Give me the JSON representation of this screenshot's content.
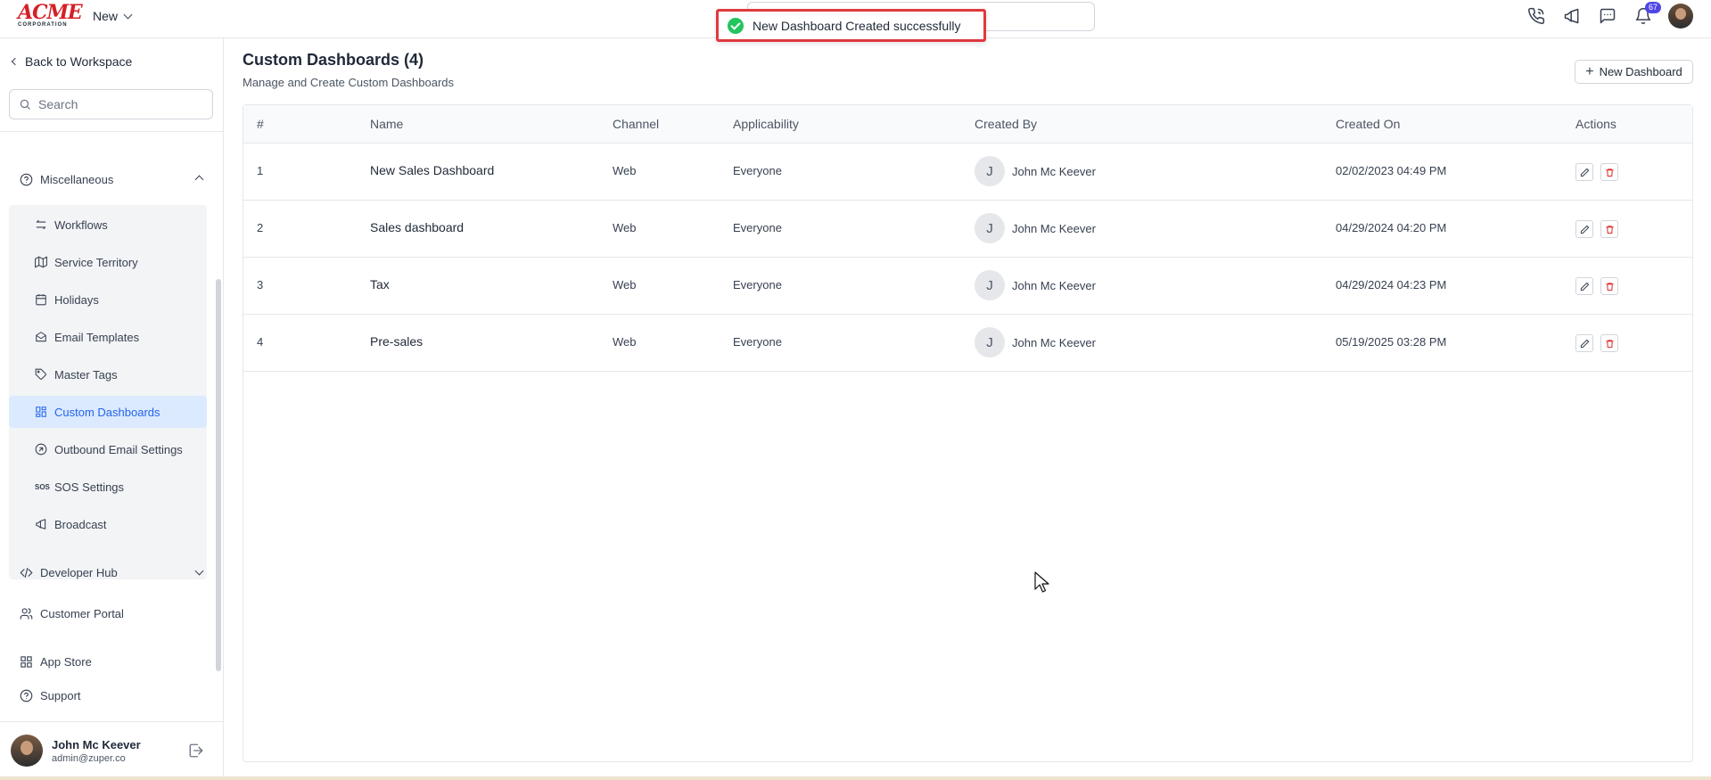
{
  "header": {
    "logo": {
      "main": "ACME",
      "sub": "CORPORATION"
    },
    "new_menu_label": "New",
    "notification_count": "67",
    "icons": [
      "phone-icon",
      "megaphone-icon",
      "chat-icon",
      "bell-icon"
    ]
  },
  "toast": {
    "message": "New Dashboard Created successfully",
    "color": "#22c55e"
  },
  "sidebar": {
    "back_label": "Back to Workspace",
    "search_placeholder": "Search",
    "section_label": "Miscellaneous",
    "sub_items": [
      {
        "label": "Workflows",
        "icon": "workflow-icon"
      },
      {
        "label": "Service Territory",
        "icon": "map-icon"
      },
      {
        "label": "Holidays",
        "icon": "calendar-icon"
      },
      {
        "label": "Email Templates",
        "icon": "mail-open-icon"
      },
      {
        "label": "Master Tags",
        "icon": "tag-icon"
      },
      {
        "label": "Custom Dashboards",
        "icon": "dashboard-icon",
        "active": true
      },
      {
        "label": "Outbound Email Settings",
        "icon": "outbound-icon"
      },
      {
        "label": "SOS Settings",
        "icon": "sos-icon"
      },
      {
        "label": "Broadcast",
        "icon": "megaphone-icon"
      }
    ],
    "developer_hub": "Developer Hub",
    "customer_portal": "Customer Portal",
    "app_store": "App Store",
    "support": "Support",
    "user": {
      "name": "John Mc Keever",
      "email": "admin@zuper.co"
    }
  },
  "main": {
    "title": "Custom Dashboards (4)",
    "subtitle": "Manage and Create Custom Dashboards",
    "new_button_label": "New Dashboard",
    "columns": [
      "#",
      "Name",
      "Channel",
      "Applicability",
      "Created By",
      "Created On",
      "Actions"
    ],
    "rows": [
      {
        "num": "1",
        "name": "New Sales Dashboard",
        "channel": "Web",
        "applicability": "Everyone",
        "initial": "J",
        "created_by": "John Mc Keever",
        "created_on": "02/02/2023 04:49 PM"
      },
      {
        "num": "2",
        "name": "Sales dashboard",
        "channel": "Web",
        "applicability": "Everyone",
        "initial": "J",
        "created_by": "John Mc Keever",
        "created_on": "04/29/2024 04:20 PM"
      },
      {
        "num": "3",
        "name": "Tax",
        "channel": "Web",
        "applicability": "Everyone",
        "initial": "J",
        "created_by": "John Mc Keever",
        "created_on": "04/29/2024 04:23 PM"
      },
      {
        "num": "4",
        "name": "Pre-sales",
        "channel": "Web",
        "applicability": "Everyone",
        "initial": "J",
        "created_by": "John Mc Keever",
        "created_on": "05/19/2025 03:28 PM"
      }
    ]
  },
  "colors": {
    "accent": "#2563eb",
    "delete": "#dc2626",
    "toast_border": "#e0393e"
  }
}
